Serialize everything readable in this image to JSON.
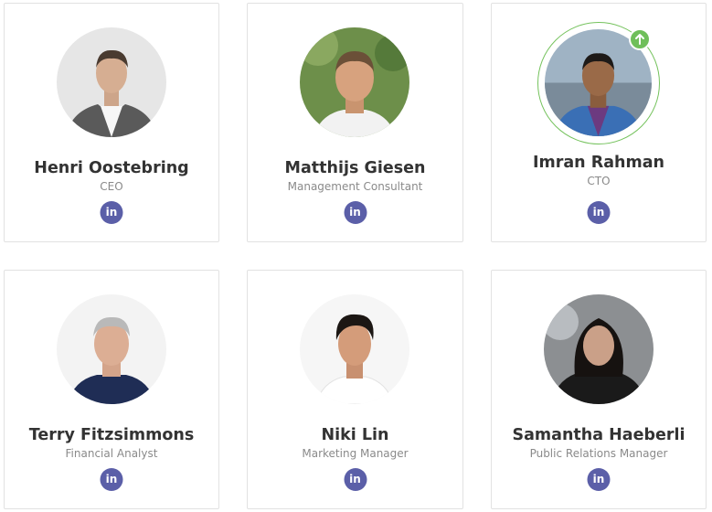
{
  "team": [
    {
      "name": "Henri Oostebring",
      "role": "CEO",
      "avatar_icon": "person-photo-icon"
    },
    {
      "name": "Matthijs Giesen",
      "role": "Management Consultant",
      "avatar_icon": "person-photo-icon"
    },
    {
      "name": "Imran Rahman",
      "role": "CTO",
      "avatar_icon": "person-photo-icon",
      "status_icon": "arrow-up-icon"
    },
    {
      "name": "Terry Fitzsimmons",
      "role": "Financial Analyst",
      "avatar_icon": "person-photo-icon"
    },
    {
      "name": "Niki Lin",
      "role": "Marketing Manager",
      "avatar_icon": "person-photo-icon"
    },
    {
      "name": "Samantha Haeberli",
      "role": "Public Relations Manager",
      "avatar_icon": "person-photo-icon"
    }
  ],
  "social": {
    "linkedin_label": "in",
    "icon": "linkedin-icon"
  },
  "colors": {
    "linkedin": "#5b5fa8",
    "online_ring": "#74c25c",
    "badge": "#6fbf5a",
    "name": "#333333",
    "role": "#8a8a8a"
  }
}
